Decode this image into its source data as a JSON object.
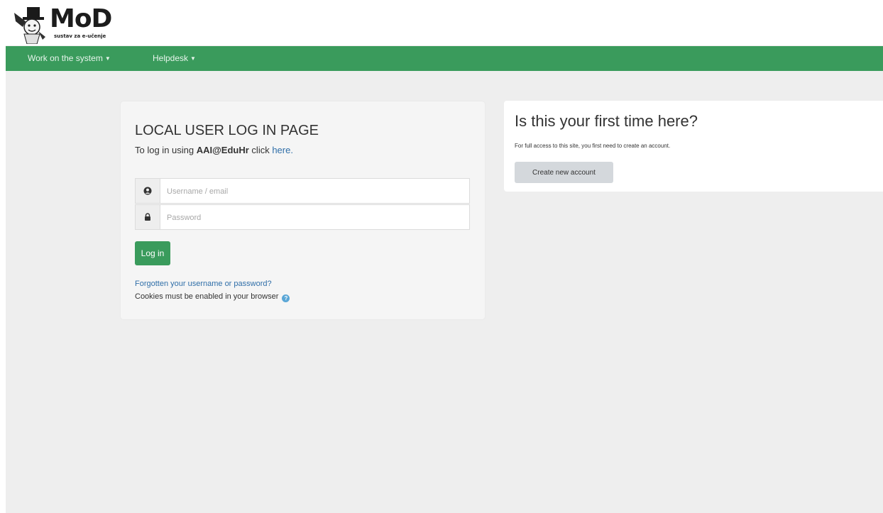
{
  "header": {
    "logo_title": "MoD",
    "logo_subtitle": "sustav za e-učenje"
  },
  "nav": {
    "items": [
      {
        "label": "Work on the system"
      },
      {
        "label": "Helpdesk"
      }
    ],
    "color": "#3a9b5c"
  },
  "login": {
    "title": "LOCAL USER LOG IN PAGE",
    "sub_prefix": "To log in using ",
    "sub_bold": "AAI@EduHr",
    "sub_middle": " click ",
    "sub_link": "here.",
    "username_placeholder": "Username / email",
    "username_value": "",
    "password_placeholder": "Password",
    "password_value": "",
    "button_label": "Log in",
    "forgot_link": "Forgotten your username or password?",
    "cookies_text": "Cookies must be enabled in your browser"
  },
  "signup": {
    "title": "Is this your first time here?",
    "text": "For full access to this site, you first need to create an account.",
    "button_label": "Create new account"
  },
  "icons": {
    "user": "user-circle-icon",
    "lock": "lock-icon",
    "help": "help-icon",
    "caret": "caret-down-icon"
  }
}
